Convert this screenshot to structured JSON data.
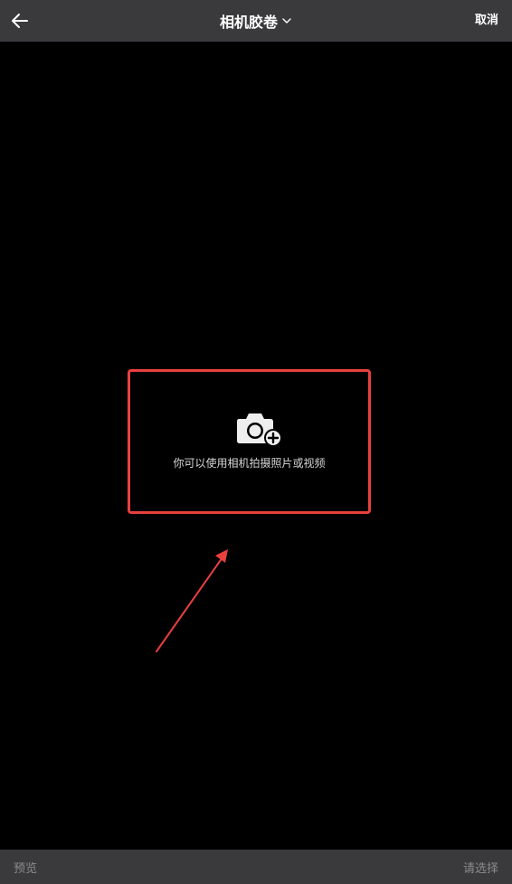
{
  "header": {
    "title": "相机胶卷",
    "cancel_label": "取消",
    "back_icon": "arrow-left-icon",
    "dropdown_icon": "chevron-down-icon"
  },
  "empty_state": {
    "icon": "camera-add-icon",
    "message": "你可以使用相机拍摄照片或视频"
  },
  "footer": {
    "preview_label": "预览",
    "select_label": "请选择"
  },
  "colors": {
    "header_bg": "#3a3a3d",
    "background": "#000000",
    "highlight": "#e8403e",
    "muted_text": "#8c8c8c"
  }
}
